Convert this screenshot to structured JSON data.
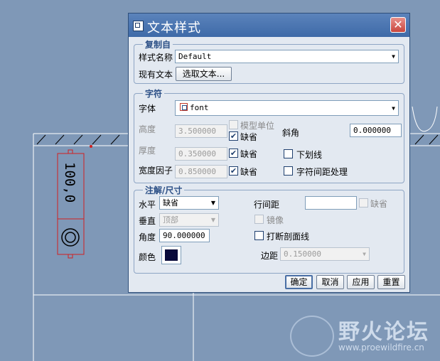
{
  "dialog": {
    "title": "文本样式",
    "close_label": "✕"
  },
  "copy_from": {
    "legend": "复制自",
    "style_name_label": "样式名称",
    "style_name_value": "Default",
    "existing_text_label": "现有文本",
    "select_text_button": "选取文本..."
  },
  "character": {
    "legend": "字符",
    "font_label": "字体",
    "font_value": "font",
    "height_label": "高度",
    "height_value": "3.500000",
    "model_units_label": "模型单位",
    "height_default_label": "缺省",
    "height_default_checked": true,
    "slant_label": "斜角",
    "slant_value": "0.000000",
    "thickness_label": "厚度",
    "thickness_value": "0.350000",
    "thickness_default_label": "缺省",
    "thickness_default_checked": true,
    "underline_label": "下划线",
    "underline_checked": false,
    "width_factor_label": "宽度因子",
    "width_factor_value": "0.850000",
    "width_default_label": "缺省",
    "width_default_checked": true,
    "kerning_label": "字符间距处理",
    "kerning_checked": false
  },
  "note_dim": {
    "legend": "注解/尺寸",
    "horizontal_label": "水平",
    "horizontal_value": "缺省",
    "vertical_label": "垂直",
    "vertical_value": "顶部",
    "angle_label": "角度",
    "angle_value": "90.000000",
    "color_label": "颜色",
    "color_value": "#0a0a3a",
    "line_spacing_label": "行间距",
    "line_spacing_value": "",
    "line_spacing_default_label": "缺省",
    "mirror_label": "镜像",
    "break_hatch_label": "打断剖面线",
    "break_hatch_checked": false,
    "margin_label": "边距",
    "margin_value": "0.150000"
  },
  "buttons": {
    "ok": "确定",
    "cancel": "取消",
    "apply": "应用",
    "reset": "重置"
  },
  "cad": {
    "dimension_text": "100,0"
  },
  "watermark": {
    "title": "野火论坛",
    "url": "www.proewildfire.cn"
  }
}
